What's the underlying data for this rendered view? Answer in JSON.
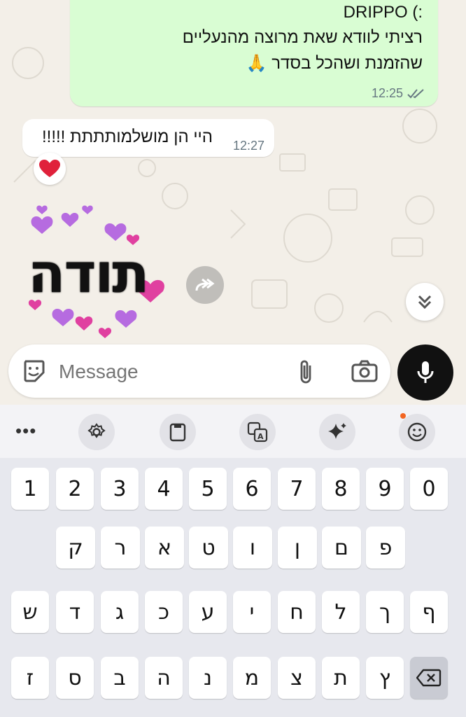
{
  "chat": {
    "outgoing": {
      "lines": [
        ":) DRIPPO",
        "רציתי לוודא שאת מרוצה מהנעליים",
        "שהזמנת ושהכל בסדר 🙏"
      ],
      "time": "12:25",
      "status_icon": "double-check-icon"
    },
    "incoming": {
      "text": "היי הן מושלמותתתת !!!!!",
      "time": "12:27",
      "reaction": "❤️"
    },
    "sticker": {
      "text": "תודה",
      "color_heart": "#b66be0"
    }
  },
  "composer": {
    "placeholder": "Message",
    "icons": [
      "sticker-icon",
      "attach-icon",
      "camera-icon",
      "mic-icon"
    ]
  },
  "keyboard": {
    "toolbar": [
      "more-icon",
      "settings-icon",
      "clipboard-icon",
      "translate-icon",
      "sparkle-icon",
      "emoji-icon"
    ],
    "rows": [
      [
        "1",
        "2",
        "3",
        "4",
        "5",
        "6",
        "7",
        "8",
        "9",
        "0"
      ],
      [
        "ק",
        "ר",
        "א",
        "ט",
        "ו",
        "ן",
        "ם",
        "פ"
      ],
      [
        "ש",
        "ד",
        "ג",
        "כ",
        "ע",
        "י",
        "ח",
        "ל",
        "ך",
        "ף"
      ],
      [
        "ז",
        "ס",
        "ב",
        "ה",
        "נ",
        "מ",
        "צ",
        "ת",
        "ץ"
      ]
    ]
  },
  "colors": {
    "outgoing_bubble": "#d9fdd3",
    "mic_button": "#111111",
    "notification_dot": "#f26522"
  }
}
